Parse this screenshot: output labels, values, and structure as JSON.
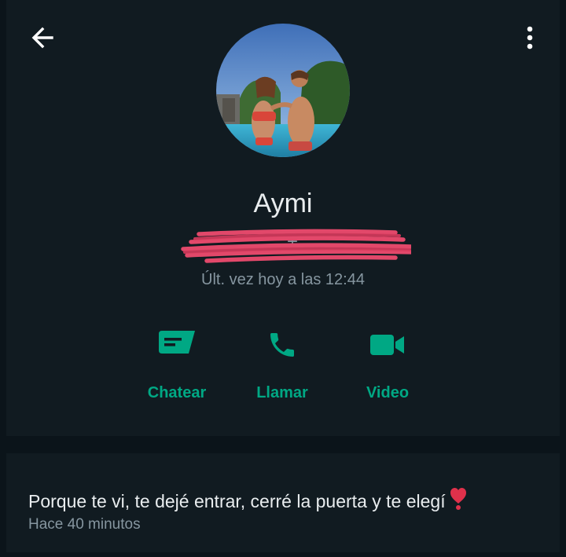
{
  "header": {
    "back_icon": "arrow-left-icon",
    "menu_icon": "more-vertical-icon"
  },
  "contact": {
    "name": "Aymi",
    "phone": "+",
    "last_seen": "Últ. vez hoy a las 12:44"
  },
  "actions": [
    {
      "label": "Chatear",
      "icon": "chat-icon"
    },
    {
      "label": "Llamar",
      "icon": "phone-icon"
    },
    {
      "label": "Video",
      "icon": "video-icon"
    }
  ],
  "about": {
    "text": "Porque te vi, te dejé entrar, cerré la puerta y te elegí",
    "time": "Hace 40 minutos"
  },
  "colors": {
    "accent": "#00a884",
    "background": "#111b21",
    "divider": "#0b141a",
    "secondary_text": "#8696a0",
    "scribble": "#e2486a"
  }
}
